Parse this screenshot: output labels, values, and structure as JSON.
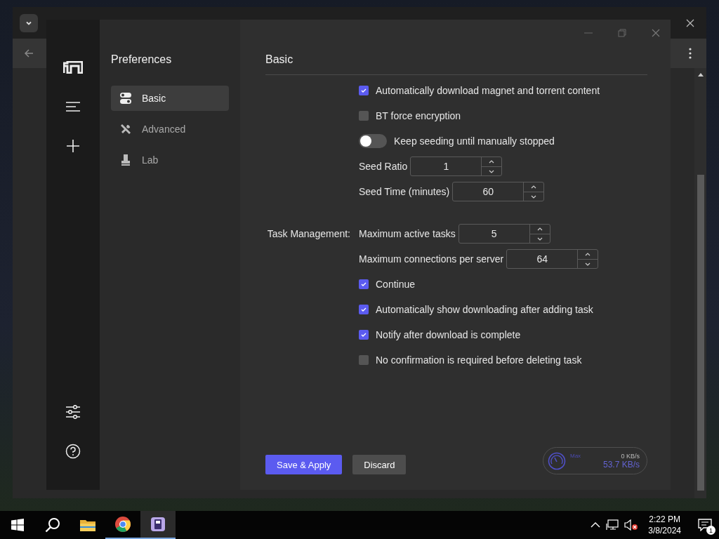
{
  "sidebar": {
    "title": "Preferences",
    "items": [
      {
        "label": "Basic",
        "selected": true
      },
      {
        "label": "Advanced",
        "selected": false
      },
      {
        "label": "Lab",
        "selected": false
      }
    ]
  },
  "main": {
    "title": "Basic",
    "sections": [
      {
        "rows": [
          {
            "kind": "checkbox",
            "label": "Automatically download magnet and torrent content",
            "checked": true
          },
          {
            "kind": "checkbox",
            "label": "BT force encryption",
            "checked": false
          },
          {
            "kind": "toggle",
            "label": "Keep seeding until manually stopped",
            "on": false
          },
          {
            "kind": "number",
            "label": "Seed Ratio",
            "value": "1"
          },
          {
            "kind": "number",
            "label": "Seed Time (minutes)",
            "value": "60"
          }
        ]
      },
      {
        "label": "Task Management:",
        "rows": [
          {
            "kind": "number",
            "label": "Maximum active tasks",
            "value": "5"
          },
          {
            "kind": "number",
            "label": "Maximum connections per server",
            "value": "64"
          },
          {
            "kind": "checkbox",
            "label": "Continue",
            "checked": true
          },
          {
            "kind": "checkbox",
            "label": "Automatically show downloading after adding task",
            "checked": true
          },
          {
            "kind": "checkbox",
            "label": "Notify after download is complete",
            "checked": true
          },
          {
            "kind": "checkbox",
            "label": "No confirmation is required before deleting task",
            "checked": false
          }
        ]
      }
    ]
  },
  "buttons": [
    {
      "label": "Save & Apply",
      "kind": "primary"
    },
    {
      "label": "Discard",
      "kind": "secondary"
    }
  ],
  "speed": {
    "label": "Max",
    "upload": "0 KB/s",
    "download": "53.7 KB/s"
  },
  "taskbar": {
    "time": "2:22 PM",
    "date": "3/8/2024",
    "notification_count": "1"
  }
}
